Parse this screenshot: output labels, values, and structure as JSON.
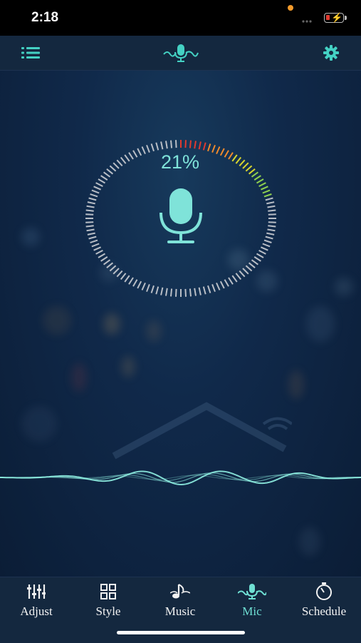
{
  "status_bar": {
    "time": "2:18",
    "battery_color": "#e03a2f"
  },
  "top_bar": {
    "left_icon": "list-icon",
    "center_icon": "mic-wave-icon",
    "right_icon": "gear-icon",
    "accent": "#44d1c3"
  },
  "gauge": {
    "percent_text": "21%",
    "level": 0.21,
    "color_scale": [
      "#e03a2f",
      "#f08a2c",
      "#d7d52e",
      "#8fd14f"
    ],
    "track_color": "#b9bec6"
  },
  "nav": {
    "items": [
      {
        "label": "Adjust",
        "icon": "equalizer-icon"
      },
      {
        "label": "Style",
        "icon": "grid-icon"
      },
      {
        "label": "Music",
        "icon": "music-note-icon"
      },
      {
        "label": "Mic",
        "icon": "mic-wave-icon",
        "active": true
      },
      {
        "label": "Schedule",
        "icon": "timer-icon"
      }
    ],
    "active_color": "#6fe0d4"
  }
}
